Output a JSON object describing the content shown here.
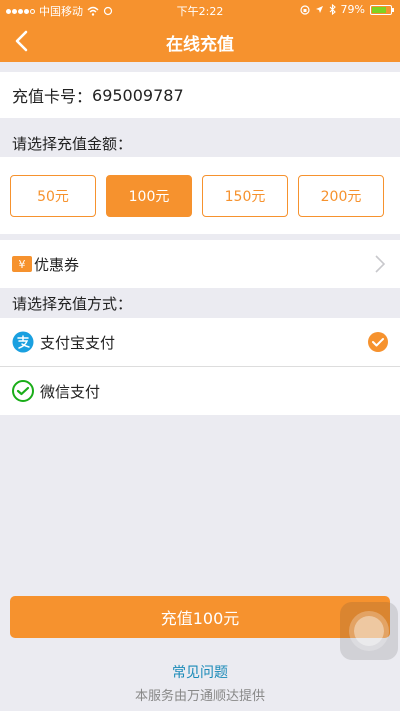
{
  "status_bar": {
    "carrier": "中国移动",
    "time": "下午2:22",
    "battery": "79%",
    "battery_level": 0.79
  },
  "header": {
    "title": "在线充值",
    "back_icon": "chevron-left-icon",
    "bg_color": "#f6922e"
  },
  "card": {
    "label": "充值卡号：",
    "number": "695009787"
  },
  "amount_section": {
    "label": "请选择充值金额：",
    "options": [
      "50元",
      "100元",
      "150元",
      "200元"
    ],
    "selected": "100元"
  },
  "coupon": {
    "icon_text": "¥",
    "label": "优惠券"
  },
  "payment_section": {
    "label": "请选择充值方式：",
    "methods": [
      {
        "label": "支付宝支付",
        "icon": "alipay-icon",
        "selected": true
      },
      {
        "label": "微信支付",
        "icon": "wechat-pay-icon",
        "selected": false
      }
    ]
  },
  "submit_label": "充值100元",
  "faq_label": "常见问题",
  "footer_note": "本服务由万通顺达提供"
}
